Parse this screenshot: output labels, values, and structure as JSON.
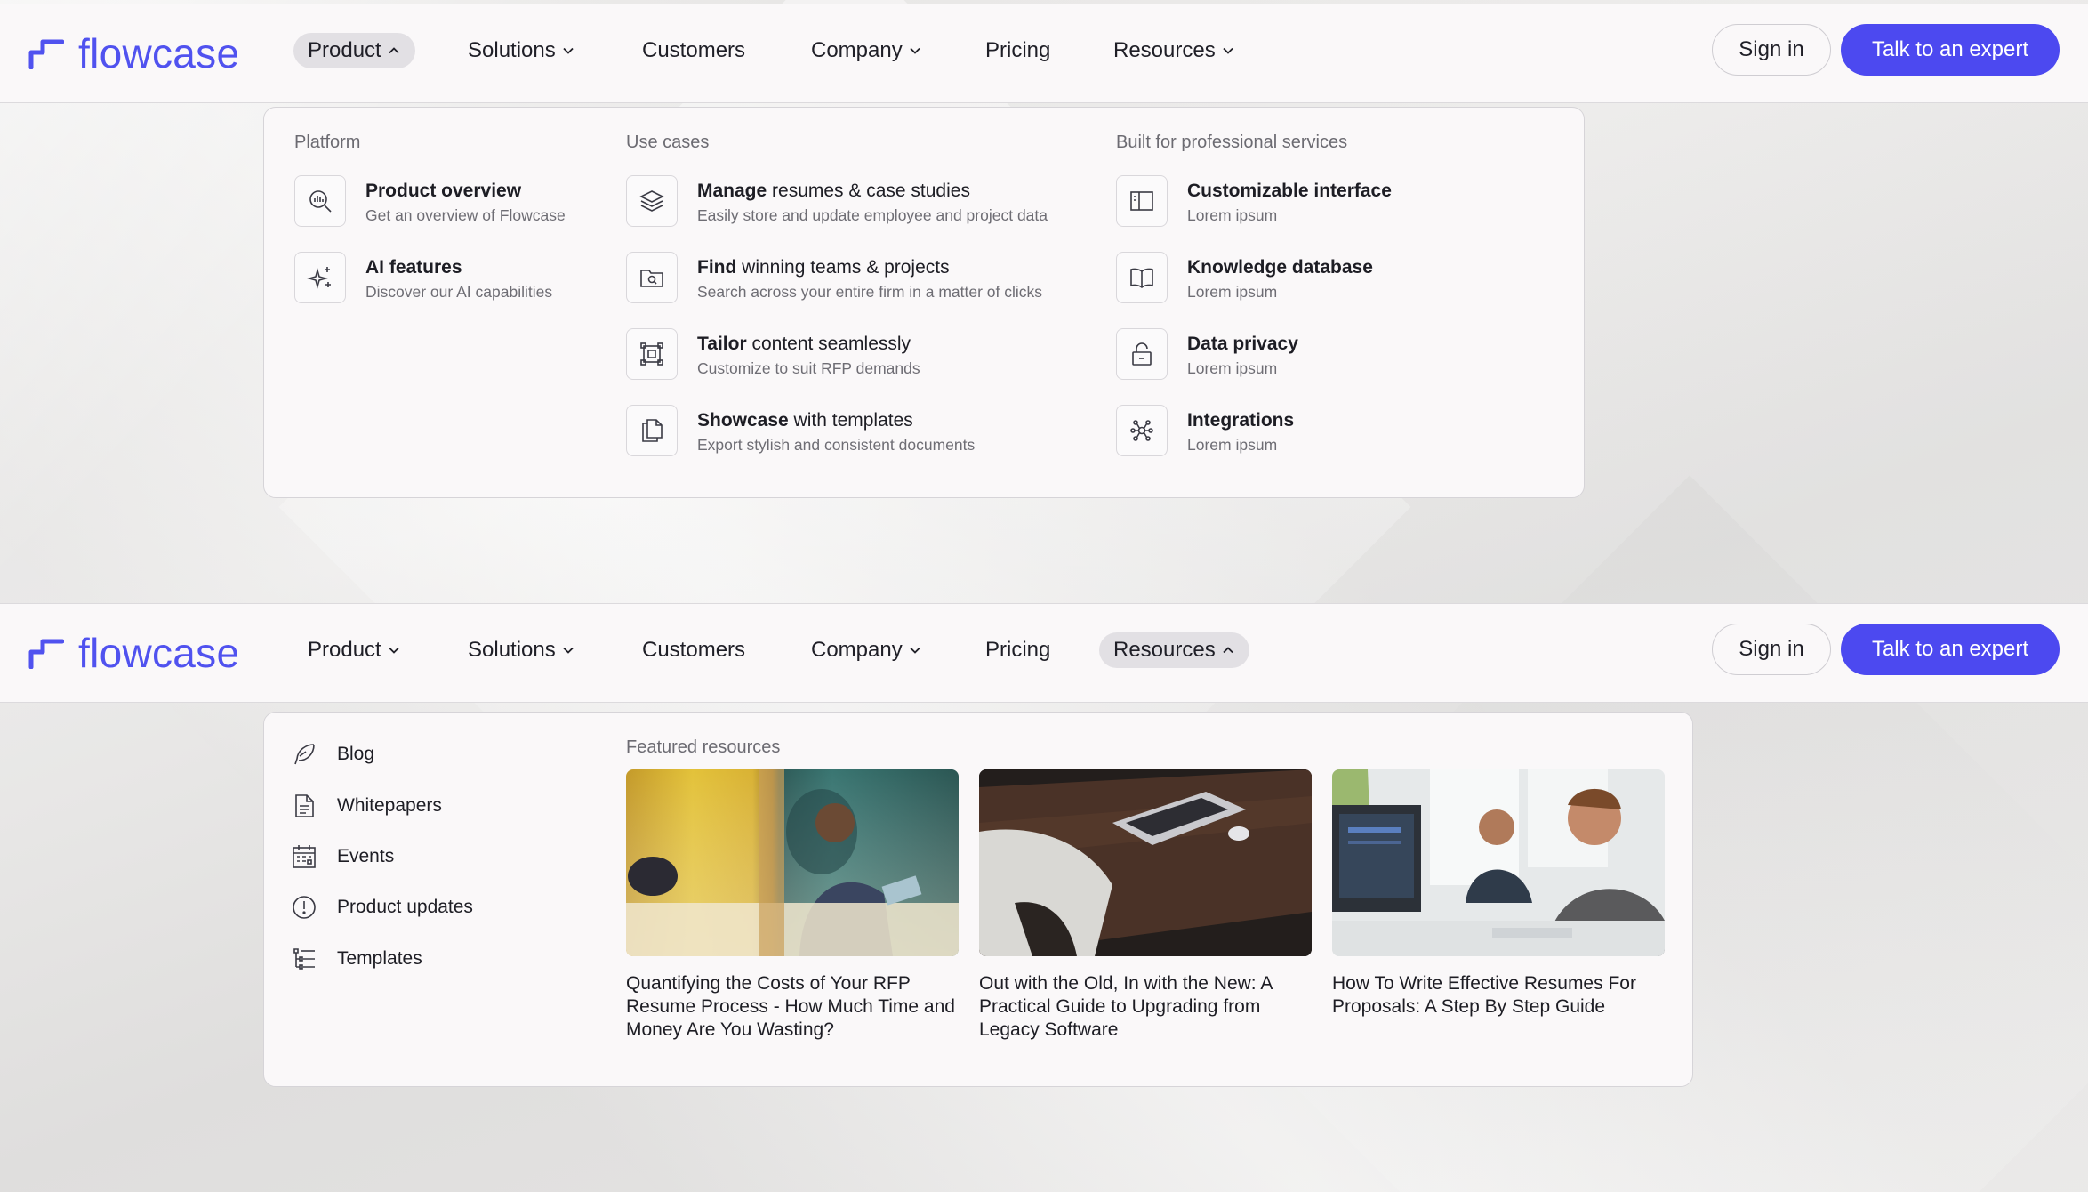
{
  "brand": {
    "name": "flowcase",
    "color": "#5052ef",
    "accent": "#4c49f0"
  },
  "nav_top": {
    "items": [
      {
        "label": "Product",
        "has_chevron": true,
        "active": true,
        "chevron": "up"
      },
      {
        "label": "Solutions",
        "has_chevron": true,
        "active": false,
        "chevron": "down"
      },
      {
        "label": "Customers",
        "has_chevron": false,
        "active": false
      },
      {
        "label": "Company",
        "has_chevron": true,
        "active": false,
        "chevron": "down"
      },
      {
        "label": "Pricing",
        "has_chevron": false,
        "active": false
      },
      {
        "label": "Resources",
        "has_chevron": true,
        "active": false,
        "chevron": "down"
      }
    ],
    "sign_in": "Sign in",
    "cta": "Talk to an expert"
  },
  "nav_bottom": {
    "items": [
      {
        "label": "Product",
        "has_chevron": true,
        "active": false,
        "chevron": "down"
      },
      {
        "label": "Solutions",
        "has_chevron": true,
        "active": false,
        "chevron": "down"
      },
      {
        "label": "Customers",
        "has_chevron": false,
        "active": false
      },
      {
        "label": "Company",
        "has_chevron": true,
        "active": false,
        "chevron": "down"
      },
      {
        "label": "Pricing",
        "has_chevron": false,
        "active": false
      },
      {
        "label": "Resources",
        "has_chevron": true,
        "active": true,
        "chevron": "up"
      }
    ],
    "sign_in": "Sign in",
    "cta": "Talk to an expert"
  },
  "product_menu": {
    "platform": {
      "title": "Platform",
      "items": [
        {
          "bold": "Product overview",
          "rest": "",
          "desc": "Get an overview of Flowcase",
          "icon": "analytics-search-icon"
        },
        {
          "bold": "AI features",
          "rest": "",
          "desc": "Discover our AI capabilities",
          "icon": "sparkles-icon"
        }
      ]
    },
    "use_cases": {
      "title": "Use cases",
      "items": [
        {
          "bold": "Manage",
          "rest": " resumes & case studies",
          "desc": "Easily store and update employee and project data",
          "icon": "layers-icon"
        },
        {
          "bold": "Find",
          "rest": " winning teams & projects",
          "desc": "Search across your entire firm in a matter of clicks",
          "icon": "folder-search-icon"
        },
        {
          "bold": "Tailor",
          "rest": " content seamlessly",
          "desc": "Customize to suit RFP demands",
          "icon": "resize-frame-icon"
        },
        {
          "bold": "Showcase",
          "rest": " with templates",
          "desc": "Export stylish and consistent documents",
          "icon": "documents-icon"
        }
      ]
    },
    "professional": {
      "title": "Built for professional services",
      "items": [
        {
          "bold": "Customizable interface",
          "rest": "",
          "desc": "Lorem ipsum",
          "icon": "layout-sidebar-icon"
        },
        {
          "bold": "Knowledge database",
          "rest": "",
          "desc": "Lorem ipsum",
          "icon": "open-book-icon"
        },
        {
          "bold": "Data privacy",
          "rest": "",
          "desc": "Lorem ipsum",
          "icon": "unlocked-padlock-icon"
        },
        {
          "bold": "Integrations",
          "rest": "",
          "desc": "Lorem ipsum",
          "icon": "network-nodes-icon"
        }
      ]
    }
  },
  "resources_menu": {
    "links": [
      {
        "label": "Blog",
        "icon": "feather-pen-icon"
      },
      {
        "label": "Whitepapers",
        "icon": "document-text-icon"
      },
      {
        "label": "Events",
        "icon": "calendar-icon"
      },
      {
        "label": "Product updates",
        "icon": "alert-circle-icon"
      },
      {
        "label": "Templates",
        "icon": "list-checklist-icon"
      }
    ],
    "featured_title": "Featured resources",
    "cards": [
      {
        "title": "Quantifying the Costs of Your RFP Resume Process - How Much Time and Money Are You Wasting?",
        "image": "man-laptop-yellow-couch-photo"
      },
      {
        "title": "Out with the Old, In with the New: A Practical Guide to Upgrading from Legacy Software",
        "image": "laptop-desk-white-chair-photo"
      },
      {
        "title": "How To Write Effective Resumes For Proposals: A Step By Step Guide",
        "image": "two-men-computers-office-photo"
      }
    ]
  }
}
